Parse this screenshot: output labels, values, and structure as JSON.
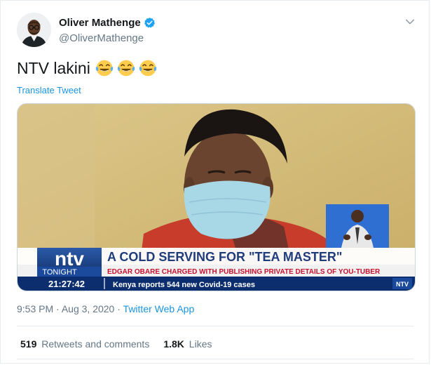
{
  "author": {
    "display_name": "Oliver Mathenge",
    "handle": "@OliverMathenge",
    "verified": true
  },
  "tweet": {
    "text": "NTV lakini",
    "emojis": [
      "face-with-tears-of-joy",
      "face-with-tears-of-joy",
      "face-with-tears-of-joy"
    ],
    "translate_label": "Translate Tweet"
  },
  "media": {
    "channel_logo": "ntv",
    "channel_sub": "TONIGHT",
    "headline": "A COLD SERVING FOR \"TEA MASTER\"",
    "subheadline": "EDGAR OBARE CHARGED WITH PUBLISHING PRIVATE DETAILS OF YOU-TUBER",
    "clock": "21:27:42",
    "ticker": "Kenya reports 544 new Covid-19 cases",
    "corner_logo": "NTV"
  },
  "meta": {
    "time": "9:53 PM",
    "date": "Aug 3, 2020",
    "separator": "·",
    "source": "Twitter Web App"
  },
  "stats": {
    "retweets_count": "519",
    "retweets_label": "Retweets and comments",
    "likes_count": "1.8K",
    "likes_label": "Likes"
  },
  "colors": {
    "link": "#1b95e0",
    "verified": "#1da1f2",
    "muted": "#657786",
    "ntv_red": "#c8102e",
    "ntv_blue": "#1f3d7a"
  }
}
